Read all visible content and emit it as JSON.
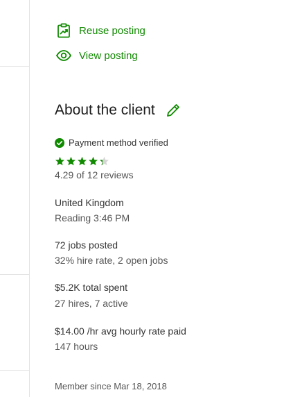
{
  "actions": {
    "reuse_label": "Reuse posting",
    "view_label": "View posting"
  },
  "client": {
    "heading": "About the client",
    "payment_status": "Payment method verified",
    "rating": 4.29,
    "reviews_text": "4.29 of 12 reviews",
    "country": "United Kingdom",
    "city_time": "Reading 3:46 PM",
    "jobs_posted": "72 jobs posted",
    "hire_rate": "32% hire rate, 2 open jobs",
    "total_spent": "$5.2K total spent",
    "hires_active": "27 hires, 7 active",
    "avg_rate": "$14.00 /hr avg hourly rate paid",
    "hours": "147 hours",
    "member_since": "Member since Mar 18, 2018"
  },
  "colors": {
    "accent": "#108a00",
    "star_empty": "#d5d5d5"
  },
  "icons": {
    "reuse": "clipboard-chart-icon",
    "view": "eye-icon",
    "edit": "pencil-icon",
    "verified": "check-circle-icon",
    "star": "star-icon"
  }
}
